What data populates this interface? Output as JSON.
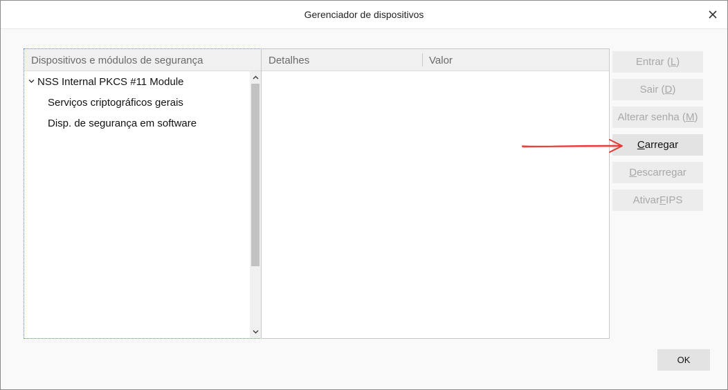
{
  "window": {
    "title": "Gerenciador de dispositivos",
    "close_icon": "close-icon"
  },
  "tree": {
    "header": "Dispositivos e módulos de segurança",
    "items": [
      {
        "label": "NSS Internal PKCS #11 Module",
        "expanded": true,
        "level": 0
      },
      {
        "label": "Serviços criptográficos gerais",
        "level": 1
      },
      {
        "label": "Disp. de segurança em software",
        "level": 1
      }
    ]
  },
  "details": {
    "columns": [
      "Detalhes",
      "Valor"
    ]
  },
  "buttons": [
    {
      "id": "login",
      "pre": "Entrar (",
      "key": "L",
      "post": ")",
      "enabled": false
    },
    {
      "id": "logout",
      "pre": "Sair (",
      "key": "D",
      "post": ")",
      "enabled": false
    },
    {
      "id": "change-password",
      "pre": "Alterar senha (",
      "key": "M",
      "post": ")",
      "enabled": false
    },
    {
      "id": "load",
      "pre": "",
      "key": "C",
      "post": "arregar",
      "enabled": true
    },
    {
      "id": "unload",
      "pre": "",
      "key": "D",
      "post": "escarregar",
      "enabled": false
    },
    {
      "id": "enable-fips",
      "pre": "Ativar ",
      "key": "F",
      "post": "IPS",
      "enabled": false
    }
  ],
  "ok_label": "OK",
  "colors": {
    "annotation_arrow": "#e53935",
    "disabled_text": "#a8a8a8",
    "focus_border": "#4a7fc1"
  }
}
